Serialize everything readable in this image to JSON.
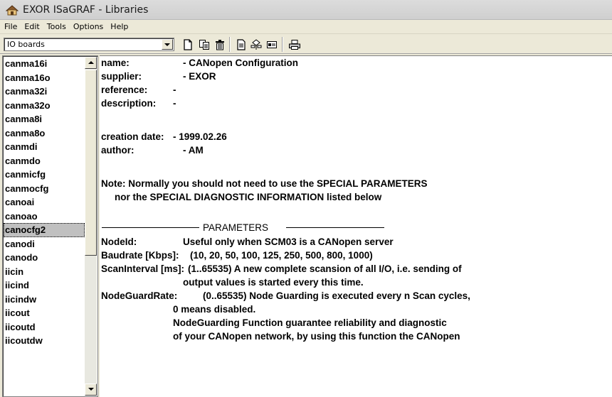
{
  "window": {
    "title": "EXOR ISaGRAF - Libraries"
  },
  "menu": [
    "File",
    "Edit",
    "Tools",
    "Options",
    "Help"
  ],
  "toolbar": {
    "combo_value": "IO boards",
    "icons": [
      "new-document-icon",
      "copy-icon",
      "delete-icon",
      "properties-icon",
      "compile-icon",
      "view-icon",
      "print-icon"
    ]
  },
  "list": {
    "items": [
      "canma16i",
      "canma16o",
      "canma32i",
      "canma32o",
      "canma8i",
      "canma8o",
      "canmdi",
      "canmdo",
      "canmicfg",
      "canmocfg",
      "canoai",
      "canoao",
      "canocfg2",
      "canodi",
      "canodo",
      "iicin",
      "iicind",
      "iicindw",
      "iicout",
      "iicoutd",
      "iicoutdw"
    ],
    "selected": "canocfg2"
  },
  "doc": {
    "name_label": "name:",
    "name_value": "- CANopen Configuration",
    "supplier_label": "supplier:",
    "supplier_value": "- EXOR",
    "reference_label": "reference:",
    "reference_value": "-",
    "description_label": "description:",
    "description_value": "-",
    "creation_label": "creation date:",
    "creation_value": "- 1999.02.26",
    "author_label": "author:",
    "author_value": "- AM",
    "note1": "Note: Normally you should not need to use the SPECIAL PARAMETERS",
    "note2": "nor the SPECIAL DIAGNOSTIC INFORMATION listed below",
    "parameters_heading": "PARAMETERS",
    "nodeid_label": "NodeId:",
    "nodeid_text": "Useful only when SCM03 is a CANopen server",
    "baud_label": "Baudrate [Kbps]:",
    "baud_text": "(10, 20, 50, 100, 125, 250, 500, 800, 1000)",
    "scan_label": "ScanInterval [ms]:",
    "scan_text": "(1..65535) A new complete scansion of all I/O, i.e. sending of",
    "scan_text2": "output values is started every this time.",
    "guard_label": "NodeGuardRate:",
    "guard_text": "(0..65535) Node Guarding is executed every n Scan cycles,",
    "guard_text2": "0 means disabled.",
    "guard_text3": "NodeGuarding Function guarantee reliability and diagnostic",
    "guard_text4": "of your CANopen network, by using this function the CANopen"
  }
}
